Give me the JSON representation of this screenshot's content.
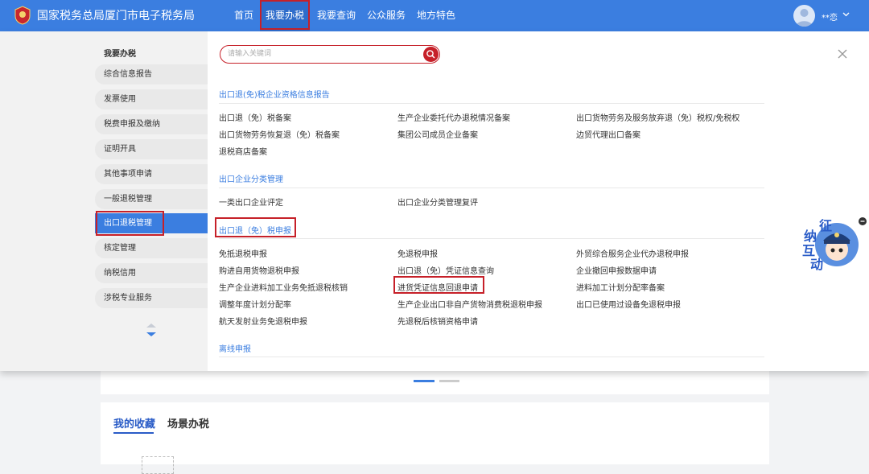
{
  "header": {
    "site_title": "国家税务总局厦门市电子税务局",
    "nav": [
      {
        "label": "首页"
      },
      {
        "label": "我要办税"
      },
      {
        "label": "我要查询"
      },
      {
        "label": "公众服务"
      },
      {
        "label": "地方特色"
      }
    ],
    "username": "**恋"
  },
  "sidebar": {
    "heading": "我要办税",
    "items": [
      {
        "label": "综合信息报告"
      },
      {
        "label": "发票使用"
      },
      {
        "label": "税费申报及缴纳"
      },
      {
        "label": "证明开具"
      },
      {
        "label": "其他事项申请"
      },
      {
        "label": "一般退税管理"
      },
      {
        "label": "出口退税管理"
      },
      {
        "label": "核定管理"
      },
      {
        "label": "纳税信用"
      },
      {
        "label": "涉税专业服务"
      }
    ]
  },
  "search": {
    "placeholder": "请输入关键词"
  },
  "categories": [
    {
      "title": "出口退(免)税企业资格信息报告",
      "links": [
        "出口退（免）税备案",
        "生产企业委托代办退税情况备案",
        "出口货物劳务及服务放弃退（免）税权/免税权",
        "出口货物劳务恢复退（免）税备案",
        "集团公司成员企业备案",
        "边贸代理出口备案",
        "退税商店备案"
      ]
    },
    {
      "title": "出口企业分类管理",
      "links": [
        "一类出口企业评定",
        "出口企业分类管理复评"
      ]
    },
    {
      "title": "出口退（免）税申报",
      "links": [
        "免抵退税申报",
        "免退税申报",
        "外贸综合服务企业代办退税申报",
        "购进自用货物退税申报",
        "出口退（免）凭证信息查询",
        "企业撤回申报数据申请",
        "生产企业进料加工业务免抵退税核销",
        "进货凭证信息回退申请",
        "进料加工计划分配率备案",
        "调整年度计划分配率",
        "生产企业出口非自产货物消费税退税申报",
        "出口已使用过设备免退税申报",
        "航天发射业务免退税申报",
        "先退税后核销资格申请"
      ]
    },
    {
      "title": "离线申报",
      "links": []
    }
  ],
  "mascot": {
    "chars": [
      "征",
      "纳",
      "互",
      "动"
    ]
  },
  "favorites": {
    "tab_favorites": "我的收藏",
    "tab_scene": "场景办税"
  },
  "colors": {
    "primary": "#3b7ee0",
    "highlight": "#c62029"
  }
}
